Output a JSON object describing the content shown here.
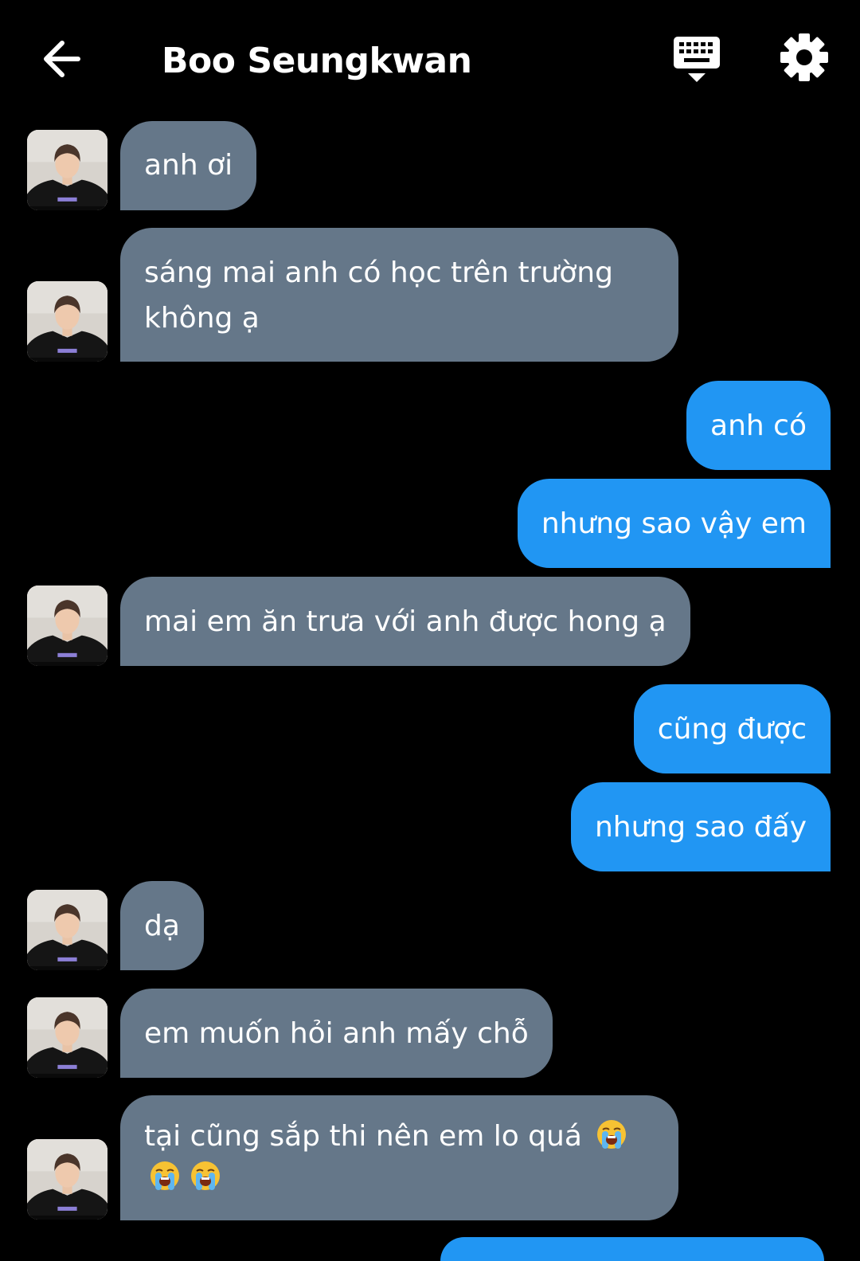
{
  "header": {
    "title": "Boo Seungkwan",
    "icons": [
      "back-arrow-icon",
      "keyboard-icon",
      "gear-icon"
    ]
  },
  "colors": {
    "background": "#000000",
    "incoming_bubble": "#657789",
    "outgoing_bubble": "#2196f3",
    "text": "#ffffff"
  },
  "messages": [
    {
      "from": "contact",
      "text": "anh ơi"
    },
    {
      "from": "contact",
      "text": "sáng mai anh có học trên trường không ạ"
    },
    {
      "from": "me",
      "text": "anh có"
    },
    {
      "from": "me",
      "text": "nhưng sao vậy em"
    },
    {
      "from": "contact",
      "text": "mai em ăn trưa với anh được hong ạ"
    },
    {
      "from": "me",
      "text": "cũng được"
    },
    {
      "from": "me",
      "text": "nhưng sao đấy"
    },
    {
      "from": "contact",
      "text": "dạ"
    },
    {
      "from": "contact",
      "text": "em muốn hỏi anh mấy chỗ"
    },
    {
      "from": "contact",
      "text": "tại cũng sắp thi nên em lo quá",
      "emoji": [
        "loudly-crying-face-icon",
        "loudly-crying-face-icon",
        "loudly-crying-face-icon"
      ]
    }
  ]
}
